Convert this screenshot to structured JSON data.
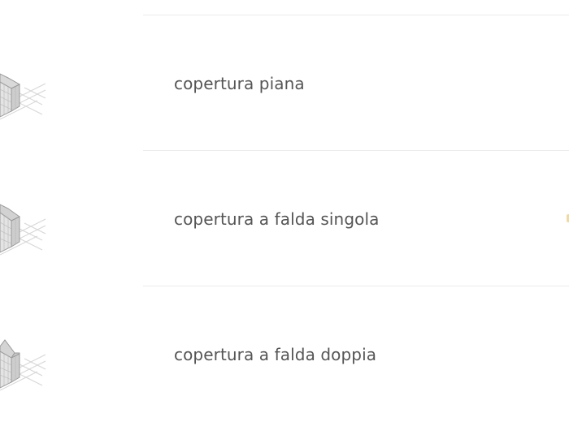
{
  "options": [
    {
      "label": "copertura piana",
      "icon": "flat-roof-building-icon"
    },
    {
      "label": "copertura a falda singola",
      "icon": "single-pitch-roof-building-icon"
    },
    {
      "label": "copertura a falda doppia",
      "icon": "double-pitch-roof-building-icon"
    }
  ],
  "colors": {
    "label_text": "#555555",
    "divider": "#ececec",
    "accent_marker": "#efd9a4"
  }
}
